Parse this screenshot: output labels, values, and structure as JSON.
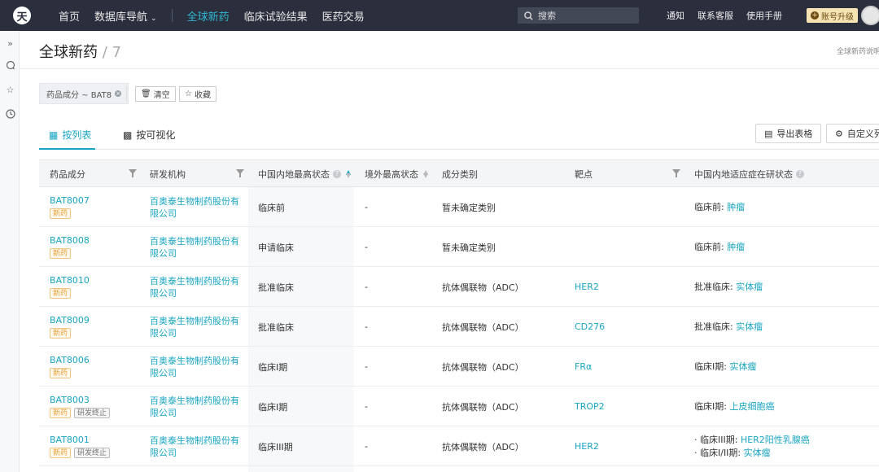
{
  "topnav": {
    "logo_text": "天",
    "items": [
      {
        "label": "首页",
        "active": false,
        "caret": false
      },
      {
        "label": "数据库导航",
        "active": false,
        "caret": true
      },
      {
        "label": "全球新药",
        "active": true,
        "caret": false
      },
      {
        "label": "临床试验结果",
        "active": false,
        "caret": false
      },
      {
        "label": "医药交易",
        "active": false,
        "caret": false
      }
    ],
    "search_placeholder": "搜索",
    "right_links": [
      "通知",
      "联系客服",
      "使用手册"
    ],
    "upgrade_label": "账号升级"
  },
  "header": {
    "title": "全球新药",
    "separator": "/",
    "count": "7",
    "help_link": "全球新药说明"
  },
  "filters": {
    "tag": "药品成分 ~ BAT8",
    "clear_label": "清空",
    "save_label": "收藏"
  },
  "tabs": [
    {
      "label": "按列表",
      "active": true
    },
    {
      "label": "按可视化",
      "active": false
    }
  ],
  "actions": {
    "export_label": "导出表格",
    "custom_label": "自定义列"
  },
  "table": {
    "columns": [
      "药品成分",
      "研发机构",
      "中国内地最高状态",
      "境外最高状态",
      "成分类别",
      "靶点",
      "中国内地适应症在研状态"
    ],
    "rows": [
      {
        "drug": "BAT8007",
        "badges": [
          "新药"
        ],
        "org": "百奥泰生物制药股份有限公司",
        "cn_status": "临床前",
        "ex_status": "-",
        "category": "暂未确定类别",
        "target": "",
        "indications": [
          {
            "phase": "临床前:",
            "disease": "肿瘤"
          }
        ]
      },
      {
        "drug": "BAT8008",
        "badges": [
          "新药"
        ],
        "org": "百奥泰生物制药股份有限公司",
        "cn_status": "申请临床",
        "ex_status": "-",
        "category": "暂未确定类别",
        "target": "",
        "indications": [
          {
            "phase": "临床前:",
            "disease": "肿瘤"
          }
        ]
      },
      {
        "drug": "BAT8010",
        "badges": [
          "新药"
        ],
        "org": "百奥泰生物制药股份有限公司",
        "cn_status": "批准临床",
        "ex_status": "-",
        "category": "抗体偶联物（ADC）",
        "target": "HER2",
        "indications": [
          {
            "phase": "批准临床:",
            "disease": "实体瘤"
          }
        ]
      },
      {
        "drug": "BAT8009",
        "badges": [
          "新药"
        ],
        "org": "百奥泰生物制药股份有限公司",
        "cn_status": "批准临床",
        "ex_status": "-",
        "category": "抗体偶联物（ADC）",
        "target": "CD276",
        "indications": [
          {
            "phase": "批准临床:",
            "disease": "实体瘤"
          }
        ]
      },
      {
        "drug": "BAT8006",
        "badges": [
          "新药"
        ],
        "org": "百奥泰生物制药股份有限公司",
        "cn_status": "临床I期",
        "ex_status": "-",
        "category": "抗体偶联物（ADC）",
        "target": "FRα",
        "indications": [
          {
            "phase": "临床I期:",
            "disease": "实体瘤"
          }
        ]
      },
      {
        "drug": "BAT8003",
        "badges": [
          "新药",
          "研发终止"
        ],
        "org": "百奥泰生物制药股份有限公司",
        "cn_status": "临床I期",
        "ex_status": "-",
        "category": "抗体偶联物（ADC）",
        "target": "TROP2",
        "indications": [
          {
            "phase": "临床I期:",
            "disease": "上皮细胞癌"
          }
        ]
      },
      {
        "drug": "BAT8001",
        "badges": [
          "新药",
          "研发终止"
        ],
        "org": "百奥泰生物制药股份有限公司",
        "cn_status": "临床III期",
        "ex_status": "-",
        "category": "抗体偶联物（ADC）",
        "target": "HER2",
        "indications": [
          {
            "phase": "· 临床III期:",
            "disease": "HER2阳性乳腺癌"
          },
          {
            "phase": "· 临床I/II期:",
            "disease": "实体瘤"
          }
        ]
      }
    ]
  },
  "colors": {
    "nav_bg": "#2b2f3d",
    "accent": "#1aa5c2",
    "new_badge": "#e8a23a",
    "upgrade_bg": "#f6e3b4"
  }
}
